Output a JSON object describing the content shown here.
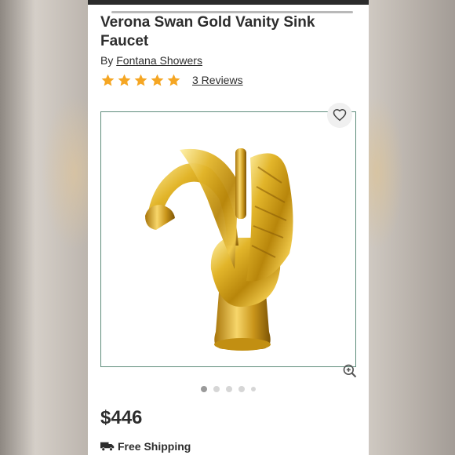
{
  "product": {
    "title": "Verona Swan Gold Vanity Sink Faucet",
    "by_prefix": "By",
    "brand": "Fontana Showers",
    "rating": 5,
    "reviews_label": "3 Reviews",
    "price": "$446",
    "shipping": "Free Shipping"
  },
  "carousel": {
    "total_slides": 5,
    "active_index": 0
  },
  "colors": {
    "star": "#f5a623",
    "frame_border": "#5e8c7b",
    "text": "#2d2d2d",
    "gold": "#d4a017"
  },
  "icons": {
    "favorite": "heart-icon",
    "zoom": "zoom-in-icon",
    "shipping": "truck-icon",
    "rating": "star-icon"
  }
}
